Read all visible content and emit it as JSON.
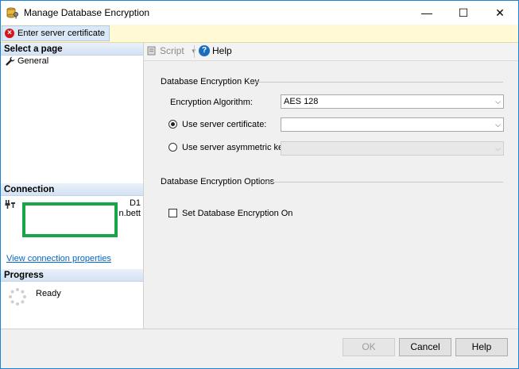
{
  "window": {
    "title": "Manage Database Encryption",
    "icon": "database-key-icon"
  },
  "caption_buttons": {
    "minimize": "—",
    "maximize": "☐",
    "close": "✕"
  },
  "error_bar": {
    "message": "Enter server certificate",
    "icon": "error-icon"
  },
  "left_pane": {
    "select_page_header": "Select a page",
    "pages": [
      {
        "label": "General",
        "icon": "wrench-icon"
      }
    ],
    "connection_header": "Connection",
    "connection_line1": "D1",
    "connection_line2": "n.bett",
    "connection_link": "View connection properties",
    "progress_header": "Progress",
    "progress_status": "Ready"
  },
  "toolbar": {
    "script_label": "Script",
    "help_label": "Help"
  },
  "key_group": {
    "title": "Database Encryption Key",
    "algorithm_label": "Encryption Algorithm:",
    "algorithm_value": "AES 128",
    "server_cert_label": "Use server certificate:",
    "server_cert_value": "",
    "asym_key_label": "Use server asymmetric key:",
    "asym_key_value": "",
    "selected_option": "server_certificate"
  },
  "options_group": {
    "title": "Database Encryption Options",
    "encryption_on_label": "Set Database Encryption On",
    "encryption_on_checked": false
  },
  "buttons": {
    "ok": "OK",
    "cancel": "Cancel",
    "help": "Help"
  },
  "colors": {
    "error_bar_bg": "#fff9d6",
    "highlight_box": "#1aa548",
    "link": "#0066cc",
    "window_border": "#1883d7"
  }
}
